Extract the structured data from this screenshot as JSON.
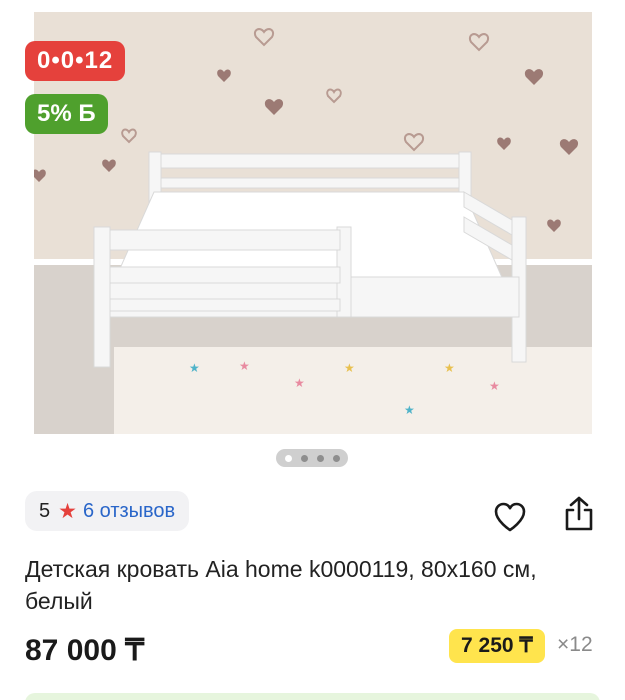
{
  "badges": {
    "timer": "0•0•12",
    "bonus": "5% Б"
  },
  "gallery": {
    "image_icon": "product-photo-bed",
    "dots_count": 4,
    "active_dot": 0
  },
  "rating": {
    "score": "5",
    "star_icon": "star-icon",
    "reviews": "6 отзывов"
  },
  "actions": {
    "favorite_icon": "heart-icon",
    "share_icon": "share-icon"
  },
  "product": {
    "title": "Детская кровать Aia home k0000119, 80x160 см, белый",
    "price": "87 000 ₸",
    "installment_price": "7 250 ₸",
    "installment_months": "×12"
  },
  "colors": {
    "timer_badge": "#e5413c",
    "bonus_badge": "#4fa02d",
    "installment_bg": "#ffe44d",
    "link": "#2a66c9"
  }
}
